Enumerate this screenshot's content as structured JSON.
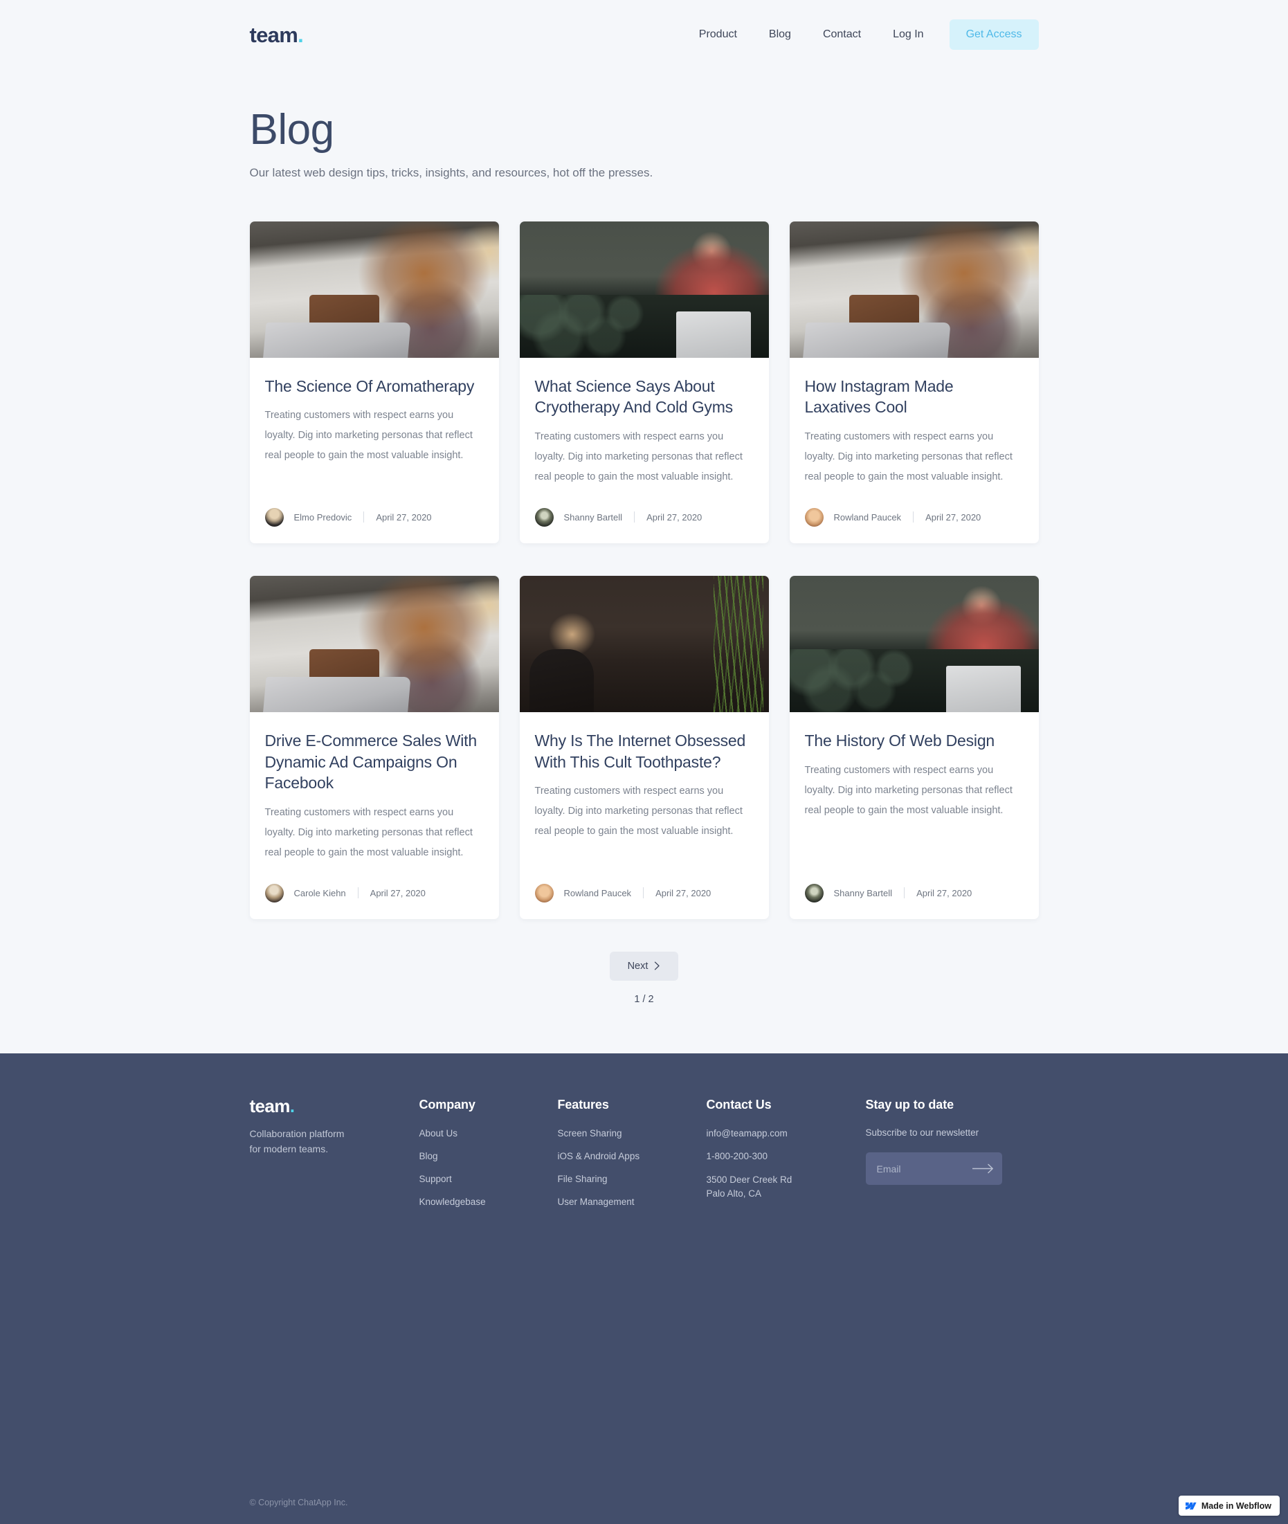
{
  "nav": {
    "brand": "team",
    "brand_dot": ".",
    "links": [
      {
        "label": "Product"
      },
      {
        "label": "Blog"
      },
      {
        "label": "Contact"
      },
      {
        "label": "Log In"
      }
    ],
    "cta_label": "Get Access"
  },
  "hero": {
    "title": "Blog",
    "subtitle": "Our latest web design tips, tricks, insights, and resources, hot off the presses."
  },
  "posts": [
    {
      "title": "The Science Of Aromatherapy",
      "excerpt": "Treating customers with respect earns you loyalty. Dig into marketing personas that reflect real people to gain the most valuable insight.",
      "author": "Elmo Predovic",
      "date": "April 27, 2020",
      "image_alt": "woman-with-red-hair-smiling-at-laptop-in-bright-cafe"
    },
    {
      "title": "What Science Says About Cryotherapy And Cold Gyms",
      "excerpt": "Treating customers with respect earns you loyalty. Dig into marketing personas that reflect real people to gain the most valuable insight.",
      "author": "Shanny Bartell",
      "date": "April 27, 2020",
      "image_alt": "person-in-red-sweater-with-laptop-on-green-leather-couch"
    },
    {
      "title": "How Instagram Made Laxatives Cool",
      "excerpt": "Treating customers with respect earns you loyalty. Dig into marketing personas that reflect real people to gain the most valuable insight.",
      "author": "Rowland Paucek",
      "date": "April 27, 2020",
      "image_alt": "woman-with-red-hair-smiling-at-laptop-in-bright-cafe"
    },
    {
      "title": "Drive E-Commerce Sales With Dynamic Ad Campaigns On Facebook",
      "excerpt": "Treating customers with respect earns you loyalty. Dig into marketing personas that reflect real people to gain the most valuable insight.",
      "author": "Carole Kiehn",
      "date": "April 27, 2020",
      "image_alt": "woman-with-red-hair-smiling-at-laptop-in-bright-cafe"
    },
    {
      "title": "Why Is The Internet Obsessed With This Cult Toothpaste?",
      "excerpt": "Treating customers with respect earns you loyalty. Dig into marketing personas that reflect real people to gain the most valuable insight.",
      "author": "Rowland Paucek",
      "date": "April 27, 2020",
      "image_alt": "blonde-woman-smiling-in-dark-room-with-plant"
    },
    {
      "title": "The History Of Web Design",
      "excerpt": "Treating customers with respect earns you loyalty. Dig into marketing personas that reflect real people to gain the most valuable insight.",
      "author": "Shanny Bartell",
      "date": "April 27, 2020",
      "image_alt": "person-in-red-sweater-with-laptop-on-green-leather-couch"
    }
  ],
  "pagination": {
    "next_label": "Next",
    "page_count": "1 / 2"
  },
  "footer": {
    "brand": "team",
    "brand_dot": ".",
    "tagline_line1": "Collaboration platform",
    "tagline_line2": "for modern teams.",
    "columns": [
      {
        "title": "Company",
        "links": [
          "About Us",
          "Blog",
          "Support",
          "Knowledgebase"
        ]
      },
      {
        "title": "Features",
        "links": [
          "Screen Sharing",
          "iOS & Android Apps",
          "File Sharing",
          "User Management"
        ]
      }
    ],
    "contact": {
      "title": "Contact Us",
      "email": "info@teamapp.com",
      "phone": "1-800-200-300",
      "address_line1": "3500 Deer Creek Rd",
      "address_line2": "Palo Alto, CA"
    },
    "newsletter": {
      "title": "Stay up to date",
      "subtitle": "Subscribe to our newsletter",
      "placeholder": "Email",
      "value": ""
    },
    "copyright": "© Copyright ChatApp Inc."
  },
  "badge": {
    "label": "Made in Webflow"
  },
  "colors": {
    "page_bg": "#f5f7fa",
    "card_bg": "#ffffff",
    "heading": "#31405f",
    "body_text": "#7c838f",
    "accent_cyan": "#4fd2e8",
    "cta_bg": "#d6f2fb",
    "cta_text": "#4fb9e8",
    "footer_bg": "#434e6b",
    "next_btn_bg": "#e6e9ef"
  }
}
